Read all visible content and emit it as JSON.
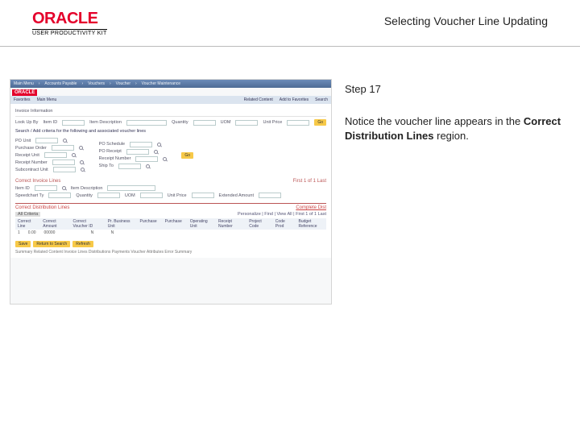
{
  "header": {
    "brand": "ORACLE",
    "subbrand": "USER PRODUCTIVITY KIT",
    "title": "Selecting Voucher Line Updating"
  },
  "side": {
    "step": "Step 17",
    "notice_pre": "Notice the voucher line appears in the ",
    "notice_bold": "Correct Distribution Lines",
    "notice_post": " region."
  },
  "ss": {
    "breadcrumb": [
      "Main Menu",
      "Accounts Payable",
      "Vouchers",
      "Voucher",
      "Voucher Maintenance"
    ],
    "menubar": [
      "Favorites",
      "Main Menu",
      "Related Content",
      "Add to Favorites",
      "Search"
    ],
    "invoice_info": "Invoice Information",
    "section1": "Look Up By",
    "fields1": [
      "Item ID",
      "Item Description",
      "Quantity",
      "UOM",
      "Unit Price"
    ],
    "go": "Go",
    "helper1": "Search / Add criteria for the following and associated voucher lines",
    "fields2_left": [
      "PO Unit",
      "Purchase Order",
      "Receipt Unit",
      "Receipt Number",
      "Subcontract Unit"
    ],
    "fields2_right": [
      "PO Schedule",
      "PO Receipt",
      "Receipt Number",
      "Ship To"
    ],
    "region1": {
      "title": "Correct Invoice Lines",
      "cols_top": [
        "Item ID",
        "Item Description"
      ],
      "cols": [
        "Speedchart Ty",
        "Quantity",
        "UOM",
        "Unit Price",
        "Extended Amount"
      ],
      "pager": "First   1 of 1   Last"
    },
    "region2": {
      "title": "Correct Distribution Lines",
      "link": "Complete Dist",
      "tabs": "All Criteria",
      "pager": "Personalize | Find | View All |   First 1 of 1 Last",
      "cols": [
        "Correct Line",
        "Correct Amount",
        "Correct Voucher ID",
        "Pr. Business Unit",
        "Purchase",
        "Purchase",
        "Operating Unit",
        "Receipt Number",
        "Project Code",
        "Code Prod",
        "Budget Reference"
      ]
    },
    "buttons": [
      "Save",
      "Return to Search",
      "Refresh"
    ],
    "footer": "Summary  Related Content  Invoice Lines  Distributions  Payments  Voucher Attributes  Error Summary"
  }
}
